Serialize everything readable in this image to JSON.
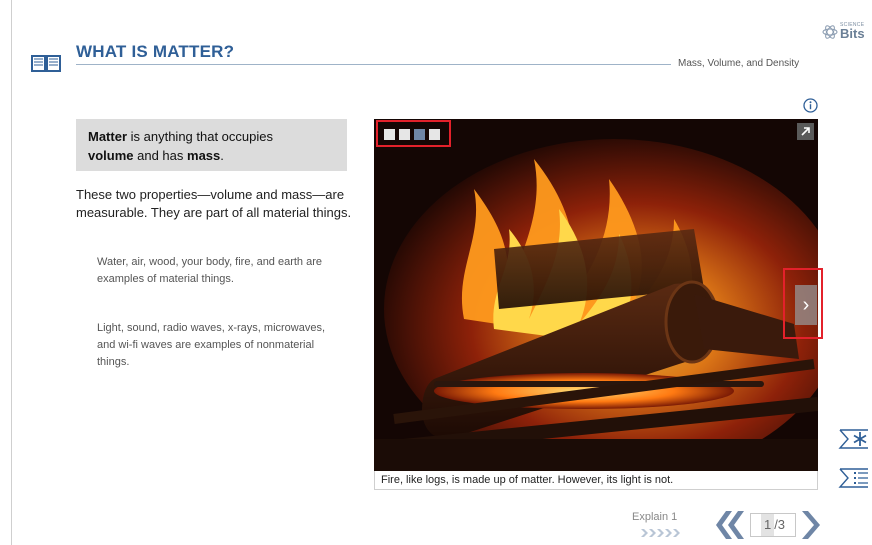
{
  "header": {
    "title": "WHAT IS MATTER?",
    "subtitle": "Mass, Volume, and Density",
    "logo_small": "SCIENCE",
    "logo_big": "Bits"
  },
  "content": {
    "definition": {
      "term": "Matter",
      "text_1": " is anything that occupies",
      "bold_2": "volume",
      "text_2": " and has ",
      "bold_3": "mass",
      "text_3": "."
    },
    "paragraph": "These two properties—volume and mass—are measurable. They are part of all material things.",
    "sub_paragraph_1": "Water, air, wood, your body, fire, and earth are examples of material things.",
    "sub_paragraph_2": "Light, sound, radio waves, x-rays, microwaves, and wi-fi waves are examples of nonmaterial things."
  },
  "media": {
    "caption": "Fire, like logs, is made up of matter. However, its light is not.",
    "slide_count": 4,
    "active_slide": 3,
    "next_glyph": "›",
    "icons": [
      "info-icon",
      "expand-icon",
      "next-slide-icon"
    ]
  },
  "sidebar": {
    "icons": [
      "glossary-star-icon",
      "list-icon"
    ]
  },
  "footer": {
    "section_label": "Explain 1",
    "page_current": "1",
    "page_total": "/3"
  },
  "colors": {
    "title_blue": "#2f5f97",
    "highlight_red": "#e3212b",
    "definition_bg": "#dcdcdc",
    "nav_blue": "#6f86a6"
  }
}
